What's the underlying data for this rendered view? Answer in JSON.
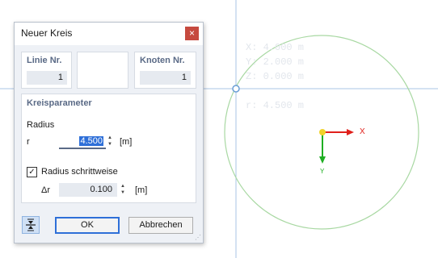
{
  "dialog": {
    "title": "Neuer Kreis",
    "close_label": "×",
    "linie": {
      "header": "Linie Nr.",
      "value": "1"
    },
    "knoten": {
      "header": "Knoten Nr.",
      "value": "1"
    },
    "kreisparameter": {
      "header": "Kreisparameter",
      "radius_label": "Radius",
      "r_label": "r",
      "r_value": "4.500",
      "r_unit": "[m]",
      "schrittweise_label": "Radius schrittweise",
      "schrittweise_checked": true,
      "check_mark": "✓",
      "dr_label": "Δr",
      "dr_value": "0.100",
      "dr_unit": "[m]"
    },
    "ok_label": "OK",
    "cancel_label": "Abbrechen"
  },
  "canvas": {
    "coord_x": "X: 4.000 m",
    "coord_y": "Y: 2.000 m",
    "coord_z": "Z: 0.000 m",
    "coord_r": "r: 4.500 m",
    "axis_x_label": "X",
    "axis_y_label": "Y",
    "colors": {
      "circle": "#a8d8a2",
      "crosshair": "#a9c4e4",
      "x_axis": "#e0201b",
      "y_axis": "#1fae22",
      "origin": "#f0d22a"
    }
  }
}
